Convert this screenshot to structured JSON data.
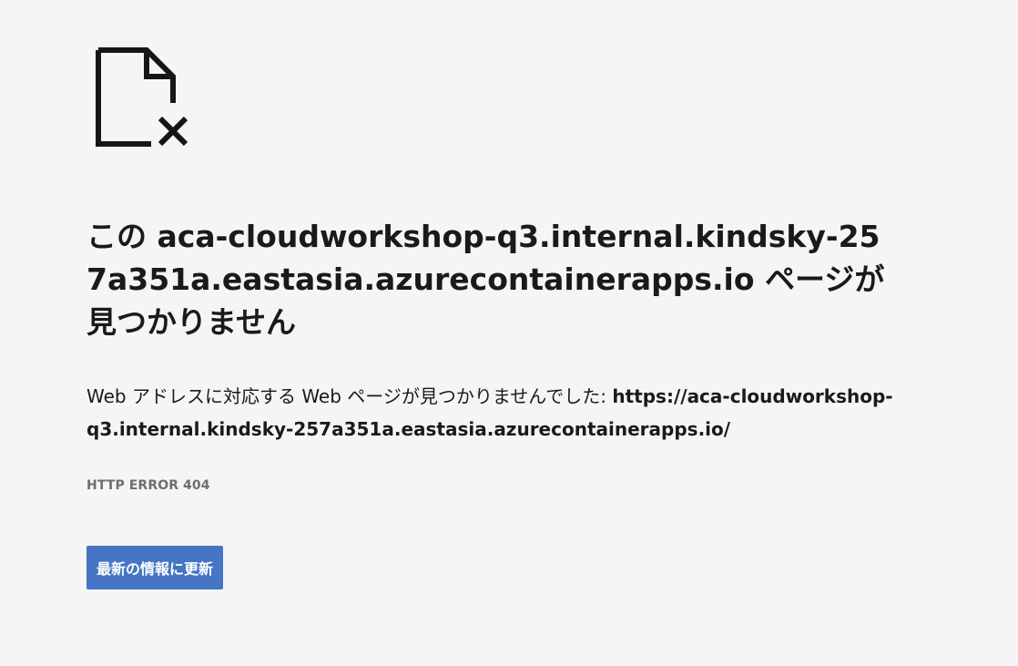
{
  "icon": "file-not-found-icon",
  "title": "この aca-cloudworkshop-q3.internal.kindsky-257a351a.eastasia.azurecontainerapps.io ページが見つかりません",
  "description": {
    "prefix": "Web アドレスに対応する Web ページが見つかりませんでした: ",
    "url": "https://aca-cloudworkshop-q3.internal.kindsky-257a351a.eastasia.azurecontainerapps.io/"
  },
  "error_code": "HTTP ERROR 404",
  "refresh_button_label": "最新の情報に更新",
  "colors": {
    "background": "#f5f5f5",
    "button": "#4575c4",
    "text": "#1a1a1a",
    "error_code": "#6e6e6e"
  }
}
